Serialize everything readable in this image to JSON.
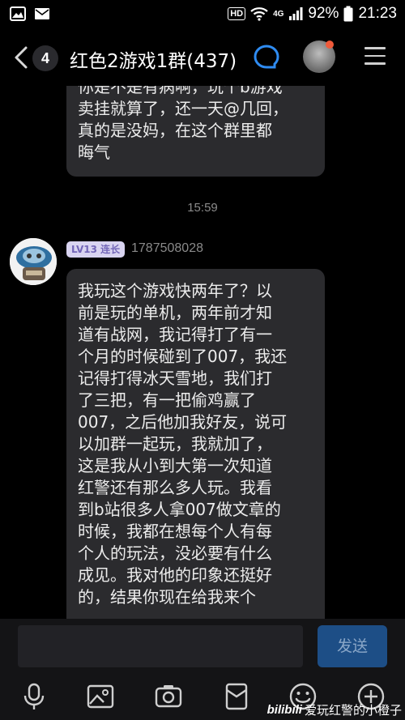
{
  "status_bar": {
    "hd": "HD",
    "network": "4G",
    "battery": "92%",
    "time": "21:23"
  },
  "header": {
    "unread_count": "4",
    "title": "红色2游戏1群(437)",
    "icons": [
      "back-chevron-icon",
      "group-chat-icon",
      "menu-icon"
    ]
  },
  "messages": [
    {
      "text": "你是不是有病啊，玩个b游戏\n卖挂就算了，还一天@几回，\n真的是没妈，在这个群里都\n晦气"
    },
    {
      "timestamp": "15:59"
    },
    {
      "level": "LV13",
      "title": "连长",
      "sender_id": "1787508028",
      "text": "我玩这个游戏快两年了？以\n前是玩的单机，两年前才知\n道有战网，我记得打了有一\n个月的时候碰到了007，我还\n记得打得冰天雪地，我们打\n了三把，有一把偷鸡赢了\n007，之后他加我好友，说可\n以加群一起玩，我就加了，\n这是我从小到大第一次知道\n红警还有那么多人玩。我看\n到b站很多人拿007做文章的\n时候，我都在想每个人有每\n个人的玩法，没必要有什么\n成见。我对他的印象还挺好\n的，结果你现在给我来个"
    }
  ],
  "input": {
    "placeholder": "",
    "send_label": "发送"
  },
  "toolbar": [
    "microphone-icon",
    "image-icon",
    "camera-icon",
    "red-packet-icon",
    "emoji-icon",
    "plus-icon"
  ],
  "watermark": {
    "logo": "bilibili",
    "text": "爱玩红警的小橙子"
  },
  "colors": {
    "background": "#000000",
    "bubble": "#2b2b2e",
    "send_button": "#1d4e86",
    "level_badge": "#d9d4f1",
    "notification_dot": "#f05a3a"
  }
}
